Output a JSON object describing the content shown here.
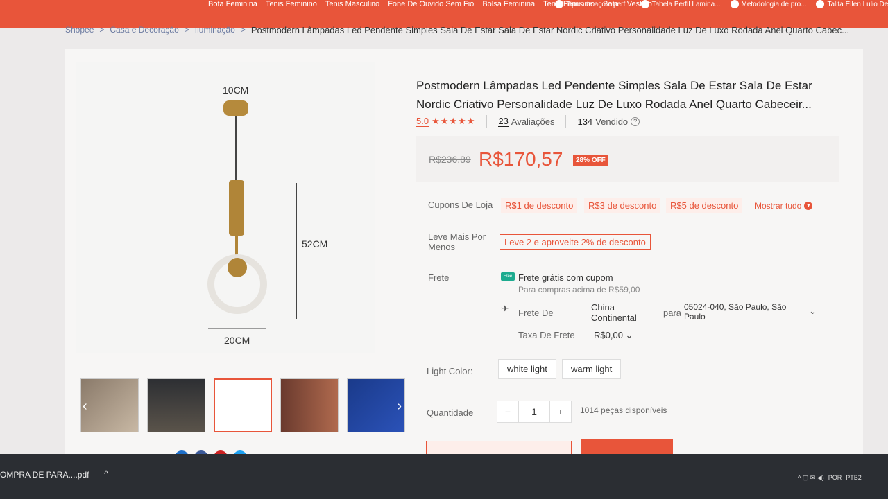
{
  "top_keywords": [
    "Bota Feminina",
    "Tenis Feminino",
    "Tenis Masculino",
    "Fone De Ouvido Sem Fio",
    "Bolsa Feminina",
    "Tenis Feminino",
    "Bota",
    "Vestido"
  ],
  "bookmarks": [
    "Tipos de aço e perf...",
    "Tabela Perfil Lamina...",
    "Metodologia de pro...",
    "Talita Ellen Lulio De..."
  ],
  "breadcrumb": {
    "items": [
      "Shopee",
      "Casa e Decoração",
      "Iluminação"
    ],
    "separator": ">",
    "current": "Postmodern Lâmpadas Led Pendente Simples Sala De Estar Sala De Estar Nordic Criativo Personalidade Luz De Luxo Rodada Anel Quarto Cabec..."
  },
  "product": {
    "title": "Postmodern Lâmpadas Led Pendente Simples Sala De Estar Sala De Estar Nordic Criativo Personalidade Luz De Luxo Rodada Anel Quarto Cabeceir...",
    "rating": "5.0",
    "stars": "★★★★★",
    "reviews_count": "23",
    "reviews_label": "Avaliações",
    "sold_count": "134",
    "sold_label": "Vendido",
    "info_icon": "?",
    "old_price": "R$236,89",
    "price": "R$170,57",
    "discount_badge": "28% OFF"
  },
  "image_dims": {
    "top": "10CM",
    "side": "52CM",
    "bottom": "20CM"
  },
  "coupons": {
    "label": "Cupons De Loja",
    "items": [
      "R$1 de desconto",
      "R$3 de desconto",
      "R$5 de desconto"
    ],
    "show_all": "Mostrar tudo"
  },
  "bulk": {
    "label": "Leve Mais Por Menos",
    "offer": "Leve 2 e aproveite 2% de desconto"
  },
  "shipping": {
    "label": "Frete",
    "free_icon": "Free",
    "free": "Frete grátis com cupom",
    "free_sub": "Para compras acima de R$59,00",
    "from_label": "Frete De",
    "from": "China Continental",
    "to_label": "para",
    "to": "05024-040, São Paulo, São Paulo",
    "fee_label": "Taxa De Frete",
    "fee": "R$0,00"
  },
  "variation": {
    "label": "Light Color:",
    "options": [
      "white light",
      "warm light"
    ]
  },
  "quantity": {
    "label": "Quantidade",
    "minus": "−",
    "value": "1",
    "plus": "+",
    "available": "1014 peças disponíveis"
  },
  "taskbar": {
    "download": "OMPRA DE PARA....pdf",
    "lang": "POR",
    "lang2": "PTB2"
  },
  "colors": {
    "brand": "#e8553a"
  }
}
